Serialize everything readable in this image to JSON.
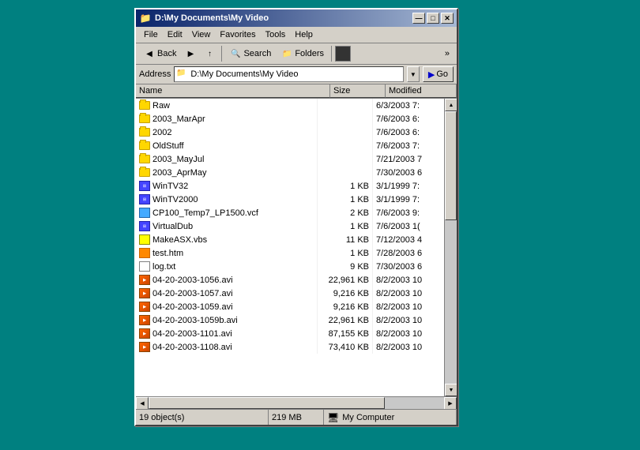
{
  "window": {
    "title": "D:\\My Documents\\My Video",
    "title_icon": "📁"
  },
  "title_buttons": {
    "minimize": "—",
    "maximize": "□",
    "close": "✕"
  },
  "menu": {
    "items": [
      "File",
      "Edit",
      "View",
      "Favorites",
      "Tools",
      "Help"
    ]
  },
  "toolbar": {
    "back_label": "Back",
    "search_label": "Search",
    "folders_label": "Folders"
  },
  "address_bar": {
    "label": "Address",
    "value": "D:\\My Documents\\My Video",
    "go_label": "Go"
  },
  "columns": {
    "name": "Name",
    "size": "Size",
    "modified": "Modified"
  },
  "files": [
    {
      "icon": "folder",
      "name": "Raw",
      "size": "",
      "modified": "6/3/2003 7:"
    },
    {
      "icon": "folder",
      "name": "2003_MarApr",
      "size": "",
      "modified": "7/6/2003 6:"
    },
    {
      "icon": "folder",
      "name": "2002",
      "size": "",
      "modified": "7/6/2003 6:"
    },
    {
      "icon": "folder",
      "name": "OldStuff",
      "size": "",
      "modified": "7/6/2003 7:"
    },
    {
      "icon": "folder",
      "name": "2003_MayJul",
      "size": "",
      "modified": "7/21/2003 7"
    },
    {
      "icon": "folder",
      "name": "2003_AprMay",
      "size": "",
      "modified": "7/30/2003 6"
    },
    {
      "icon": "media",
      "name": "WinTV32",
      "size": "1 KB",
      "modified": "3/1/1999 7:"
    },
    {
      "icon": "media",
      "name": "WinTV2000",
      "size": "1 KB",
      "modified": "3/1/1999 7:"
    },
    {
      "icon": "vcf",
      "name": "CP100_Temp7_LP1500.vcf",
      "size": "2 KB",
      "modified": "7/6/2003 9:"
    },
    {
      "icon": "media",
      "name": "VirtualDub",
      "size": "1 KB",
      "modified": "7/6/2003 1("
    },
    {
      "icon": "vbs",
      "name": "MakeASX.vbs",
      "size": "11 KB",
      "modified": "7/12/2003 4"
    },
    {
      "icon": "html",
      "name": "test.htm",
      "size": "1 KB",
      "modified": "7/28/2003 6"
    },
    {
      "icon": "txt",
      "name": "log.txt",
      "size": "9 KB",
      "modified": "7/30/2003 6"
    },
    {
      "icon": "avi",
      "name": "04-20-2003-1056.avi",
      "size": "22,961 KB",
      "modified": "8/2/2003 10"
    },
    {
      "icon": "avi",
      "name": "04-20-2003-1057.avi",
      "size": "9,216 KB",
      "modified": "8/2/2003 10"
    },
    {
      "icon": "avi",
      "name": "04-20-2003-1059.avi",
      "size": "9,216 KB",
      "modified": "8/2/2003 10"
    },
    {
      "icon": "avi",
      "name": "04-20-2003-1059b.avi",
      "size": "22,961 KB",
      "modified": "8/2/2003 10"
    },
    {
      "icon": "avi",
      "name": "04-20-2003-1101.avi",
      "size": "87,155 KB",
      "modified": "8/2/2003 10"
    },
    {
      "icon": "avi",
      "name": "04-20-2003-1108.avi",
      "size": "73,410 KB",
      "modified": "8/2/2003 10"
    }
  ],
  "status": {
    "objects": "19 object(s)",
    "size": "219 MB",
    "computer": "My Computer"
  }
}
